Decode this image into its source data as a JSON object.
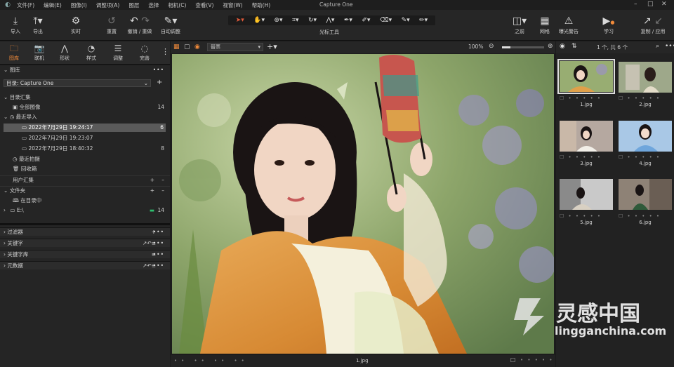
{
  "menu": {
    "items": [
      "文件(F)",
      "编辑(E)",
      "图像(I)",
      "调整项(A)",
      "图层",
      "选择",
      "相机(C)",
      "查看(V)",
      "视窗(W)",
      "帮助(H)"
    ],
    "title": "Capture One"
  },
  "toolbar": {
    "import": "导入",
    "export": "导出",
    "live": "实时",
    "reset": "重置",
    "undo_redo": "撤销 / 重做",
    "auto_adjust": "自动调整",
    "cursor_tools": "光标工具",
    "before": "之前",
    "grid": "网格",
    "exposure_warning": "曝光警告",
    "learn": "学习",
    "copy_apply": "复制 / 应用"
  },
  "left_tabs": [
    "图库",
    "联机",
    "形状",
    "样式",
    "调整",
    "完善"
  ],
  "library": {
    "header": "图库",
    "catalog_label": "目录: Capture One",
    "catalog_collections": "目录汇集",
    "all_images": "全部图像",
    "all_images_count": "14",
    "recent_imports": "最近导入",
    "imports": [
      {
        "label": "2022年7月29日 19:24:17",
        "count": "6"
      },
      {
        "label": "2022年7月29日 19:23:07",
        "count": ""
      },
      {
        "label": "2022年7月29日 18:40:32",
        "count": "8"
      }
    ],
    "recent_captures": "最近拍摄",
    "trash": "回收箱",
    "user_collections": "用户汇集",
    "folders": "文件夹",
    "in_catalog": "在目录中",
    "drive": "E:\\",
    "drive_count": "14"
  },
  "tool_sections": [
    "过滤器",
    "关键字",
    "关键字库",
    "元数据"
  ],
  "viewer": {
    "sort_label": "替票",
    "zoom": "100%",
    "filename": "1.jpg"
  },
  "browser": {
    "count_label": "1 个, 共 6 个",
    "thumbs": [
      "1.jpg",
      "2.jpg",
      "3.jpg",
      "4.jpg",
      "5.jpg",
      "6.jpg"
    ]
  },
  "watermark": {
    "cn": "灵感中国",
    "en": "lingganchina.com"
  },
  "colors": {
    "accent": "#f08a3a",
    "cursor_active": "#e05a3a"
  }
}
